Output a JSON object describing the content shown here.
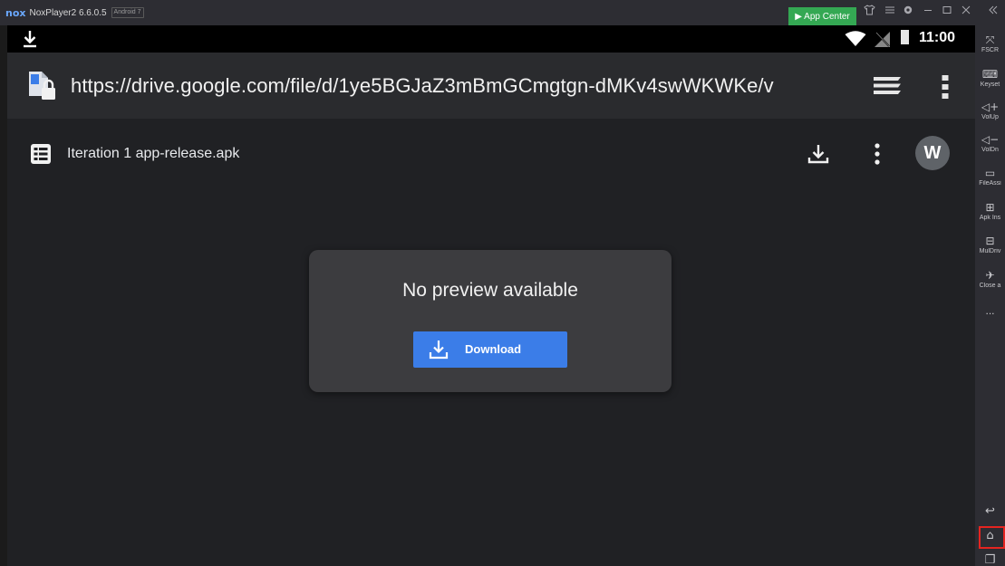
{
  "titlebar": {
    "logo": "nox",
    "app_name": "NoxPlayer2 6.6.0.5",
    "badge": "Android 7",
    "app_center": "▶ App Center",
    "icons": [
      "shirt-icon",
      "menu-icon",
      "settings-icon",
      "minimize-icon",
      "maximize-icon",
      "close-icon",
      "collapse-icon"
    ]
  },
  "statusbar": {
    "time": "11:00",
    "icons": [
      "download-icon",
      "wifi-icon",
      "no-sim-icon",
      "battery-icon"
    ]
  },
  "browser": {
    "url": "https://drive.google.com/file/d/1ye5BGJaZ3mBmGCmgtgn-dMKv4swWKWKe/v"
  },
  "drive": {
    "file_name": "Iteration 1 app-release.apk",
    "avatar_letter": "W"
  },
  "preview": {
    "message": "No preview available",
    "download_label": "Download"
  },
  "toolbar": {
    "items": [
      {
        "label": "FSCR",
        "icon": "fullscreen-icon",
        "glyph": "⤧"
      },
      {
        "label": "Keyset",
        "icon": "keyboard-icon",
        "glyph": "⌨"
      },
      {
        "label": "VolUp",
        "icon": "volume-up-icon",
        "glyph": "◁+"
      },
      {
        "label": "VolDn",
        "icon": "volume-down-icon",
        "glyph": "◁−"
      },
      {
        "label": "FileAssi",
        "icon": "file-assistant-icon",
        "glyph": "▭"
      },
      {
        "label": "Apk Ins",
        "icon": "apk-install-icon",
        "glyph": "⊞"
      },
      {
        "label": "MulDriv",
        "icon": "multi-drive-icon",
        "glyph": "⊟"
      },
      {
        "label": "Close a",
        "icon": "rocket-icon",
        "glyph": "✈"
      }
    ],
    "more": "...",
    "nav": {
      "back": "↩",
      "home": "⌂",
      "recents": "❐"
    }
  }
}
